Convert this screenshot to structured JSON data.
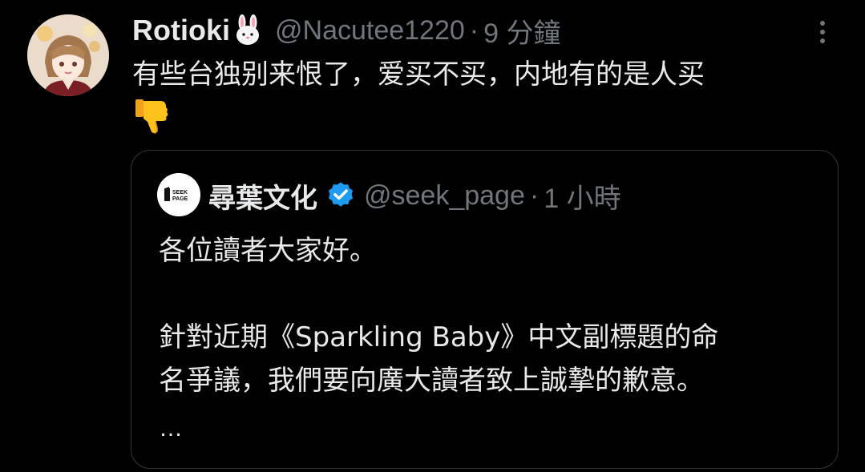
{
  "tweet": {
    "author": {
      "display_name": "Rotioki",
      "name_emoji": "rabbit-face-icon",
      "handle": "@Nacutee1220",
      "separator": "·",
      "time_ago": "9 分鐘"
    },
    "text": "有些台独别来恨了，爱买不买，内地有的是人买",
    "reaction_emoji": "thumbs-down-icon",
    "more_icon": "more-vertical-icon"
  },
  "quoted_tweet": {
    "author": {
      "display_name": "尋葉文化",
      "verified": true,
      "verified_color": "#1d9bf0",
      "handle": "@seek_page",
      "separator": "·",
      "time_ago": "1 小時"
    },
    "avatar_label_1": "SEEK",
    "avatar_label_2": "PAGE",
    "body_lines": [
      "各位讀者大家好。",
      "",
      "針對近期《Sparkling Baby》中文副標題的命",
      "名爭議，我們要向廣大讀者致上誠摯的歉意。"
    ],
    "ellipsis": "…"
  },
  "colors": {
    "background": "#000000",
    "text_primary": "#e7e9ea",
    "text_secondary": "#71767b",
    "border": "#333639"
  }
}
